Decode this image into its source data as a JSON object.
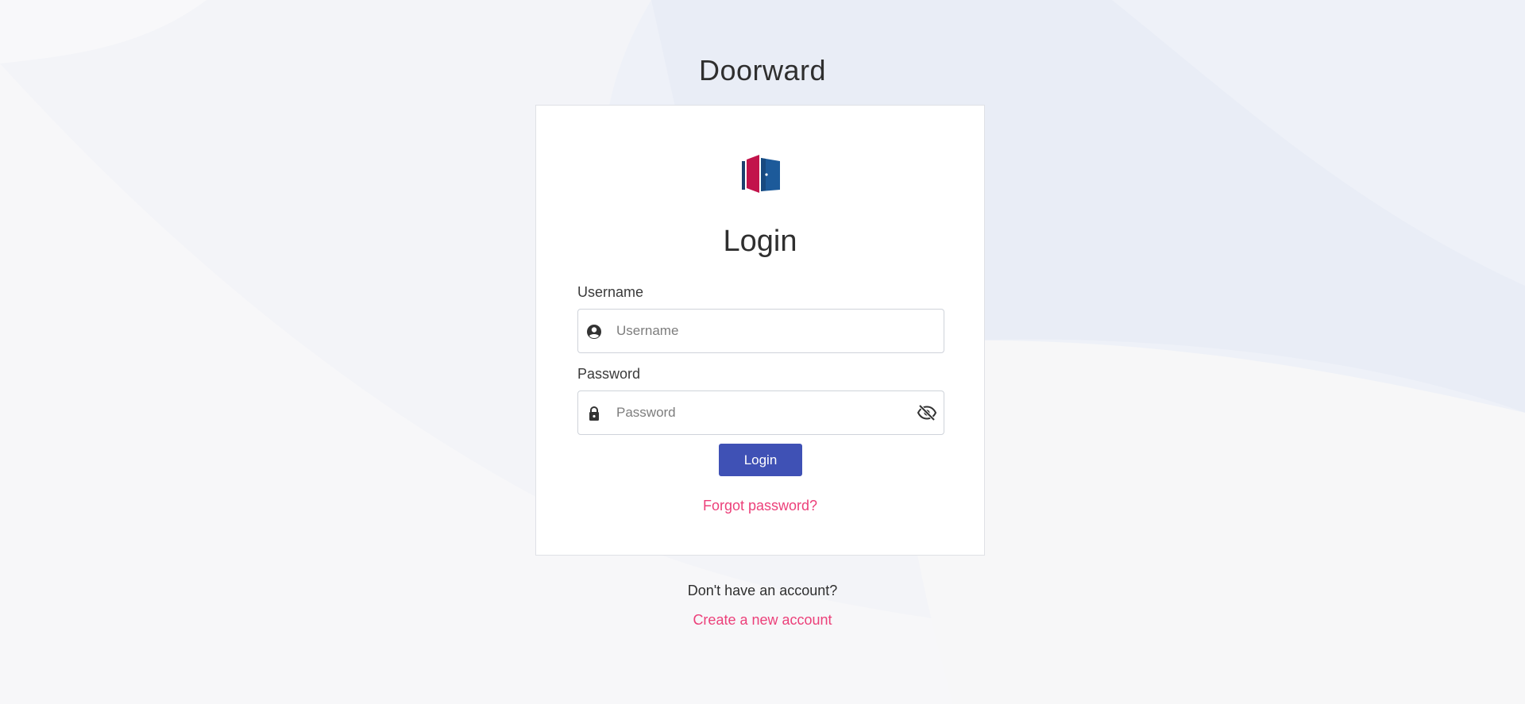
{
  "app": {
    "title": "Doorward"
  },
  "login_card": {
    "logo_icon": "door-logo-icon",
    "heading": "Login",
    "username": {
      "label": "Username",
      "placeholder": "Username",
      "value": "",
      "icon": "user-circle-icon"
    },
    "password": {
      "label": "Password",
      "placeholder": "Password",
      "value": "",
      "icon": "lock-icon",
      "toggle_icon": "eye-off-icon"
    },
    "login_button_label": "Login",
    "forgot_password_label": "Forgot password?"
  },
  "footer": {
    "no_account_text": "Don't have an account?",
    "create_account_label": "Create a new account"
  },
  "colors": {
    "primary_button": "#3f51b5",
    "link": "#ec407a",
    "logo_red": "#c2134b",
    "logo_blue": "#1c5a9a",
    "background": "#eef1f8"
  }
}
